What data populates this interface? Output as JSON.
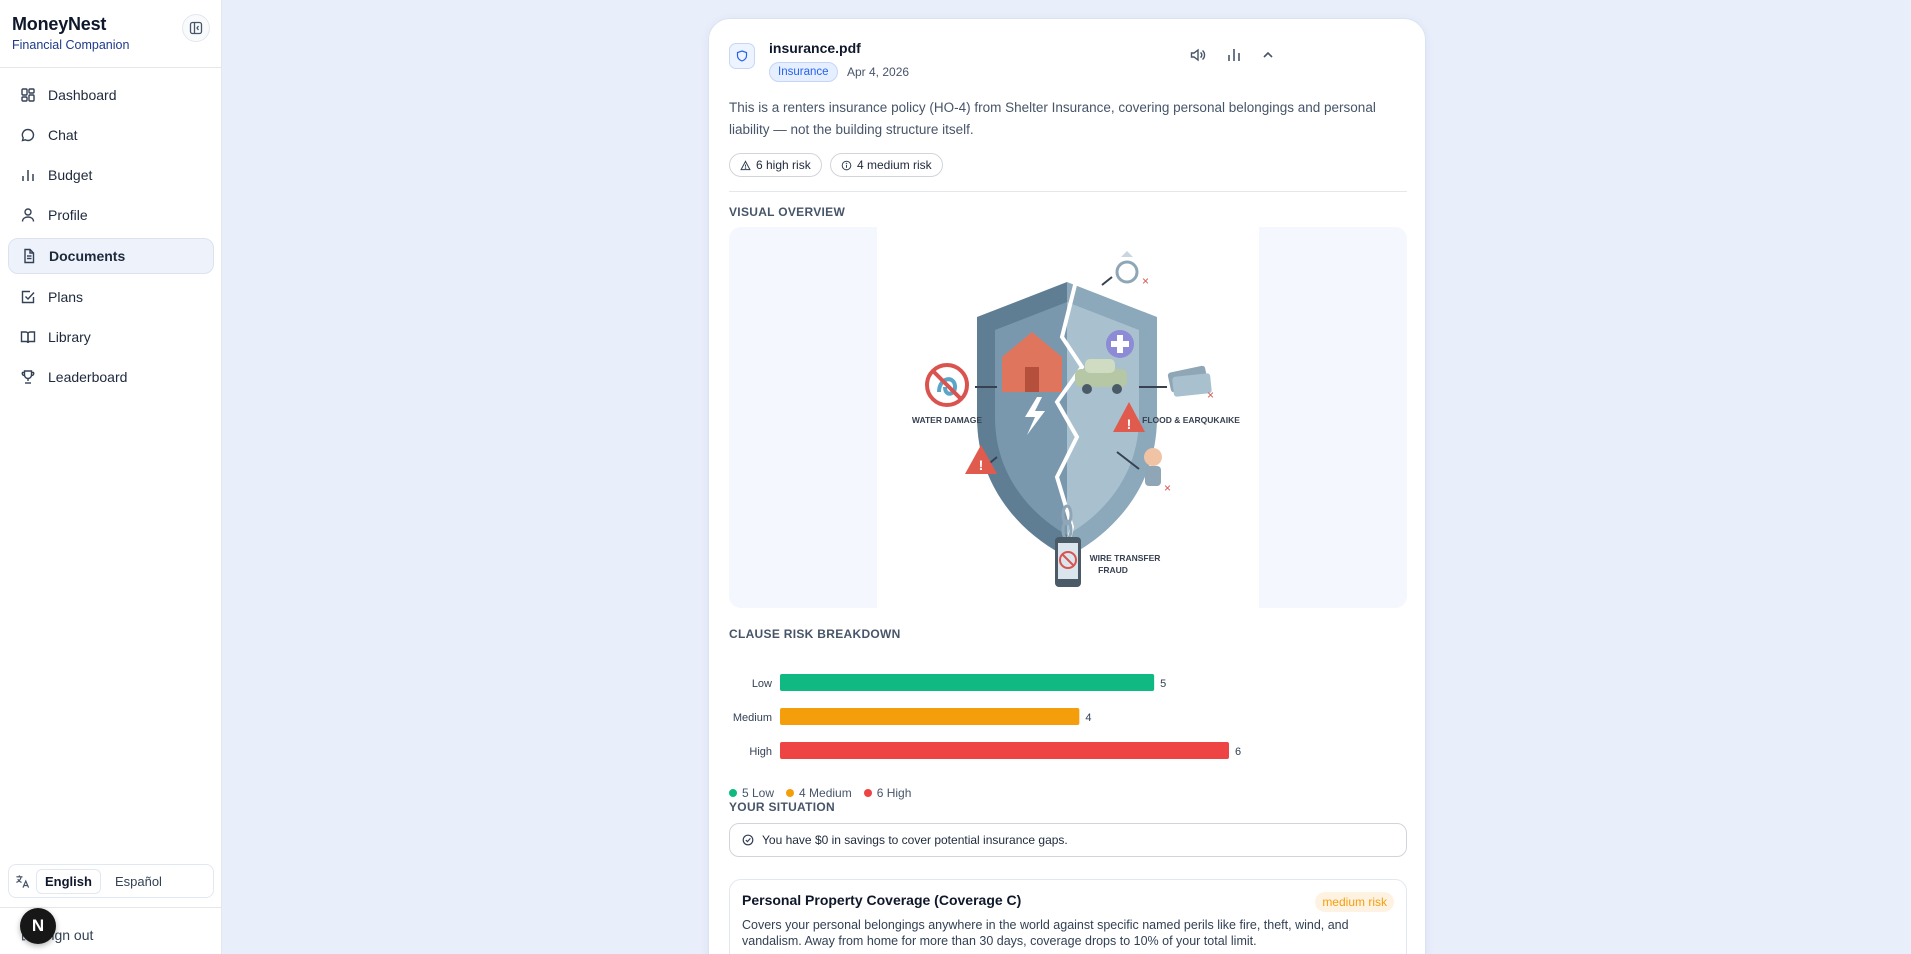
{
  "sidebar": {
    "brand_name": "MoneyNest",
    "brand_tagline": "Financial Companion",
    "items": [
      {
        "label": "Dashboard",
        "icon": "dashboard-icon"
      },
      {
        "label": "Chat",
        "icon": "chat-icon"
      },
      {
        "label": "Budget",
        "icon": "bar-chart-icon"
      },
      {
        "label": "Profile",
        "icon": "user-icon"
      },
      {
        "label": "Documents",
        "icon": "document-icon",
        "active": true
      },
      {
        "label": "Plans",
        "icon": "checkbox-icon"
      },
      {
        "label": "Library",
        "icon": "book-icon"
      },
      {
        "label": "Leaderboard",
        "icon": "trophy-icon"
      }
    ],
    "languages": [
      "English",
      "Español"
    ],
    "active_language": "English",
    "sign_out": "Sign out",
    "fab_letter": "N"
  },
  "document": {
    "filename": "insurance.pdf",
    "category": "Insurance",
    "date": "Apr 4, 2026",
    "summary": "This is a renters insurance policy (HO-4) from Shelter Insurance, covering personal belongings and personal liability — not the building structure itself.",
    "high_risk_label": "6 high risk",
    "medium_risk_label": "4 medium risk",
    "visual_overview_heading": "VISUAL OVERVIEW",
    "illustration_labels": {
      "water": "WATER DAMAGE",
      "flood": "FLOOD & EARQUKAIKE",
      "wire_1": "WIRE TRANSFER",
      "wire_2": "FRAUD"
    },
    "risk_breakdown_heading": "CLAUSE RISK BREAKDOWN",
    "situation_heading": "YOUR SITUATION",
    "situation_text": "You have $0 in savings to cover potential insurance gaps.",
    "clause": {
      "title": "Personal Property Coverage (Coverage C)",
      "risk": "medium risk",
      "text": "Covers your personal belongings anywhere in the world against specific named perils like fire, theft, wind, and vandalism. Away from home for more than 30 days, coverage drops to 10% of your total limit."
    }
  },
  "chart_data": {
    "type": "bar",
    "orientation": "horizontal",
    "categories": [
      "Low",
      "Medium",
      "High"
    ],
    "values": [
      5,
      4,
      6
    ],
    "colors": [
      "#10b981",
      "#f59e0b",
      "#ef4444"
    ],
    "legend": [
      "5 Low",
      "4 Medium",
      "6 High"
    ],
    "xlim": [
      0,
      6
    ]
  },
  "colors": {
    "accent": "#2563eb",
    "low": "#10b981",
    "medium": "#f59e0b",
    "high": "#ef4444"
  }
}
